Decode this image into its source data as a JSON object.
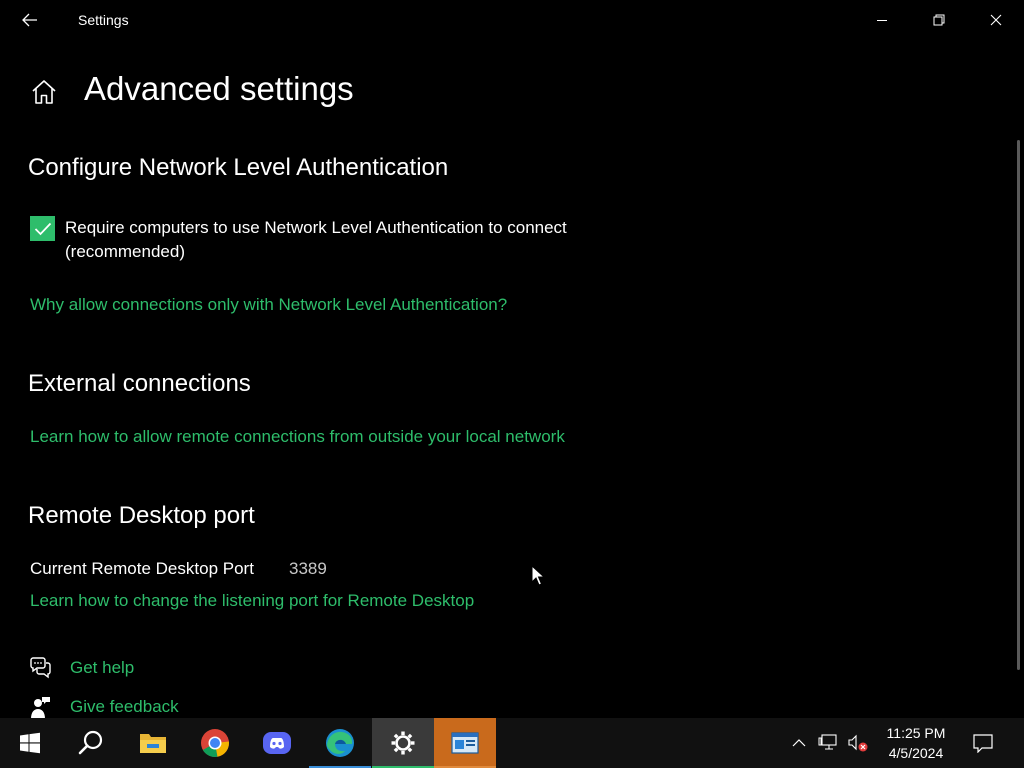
{
  "window": {
    "title": "Settings"
  },
  "page": {
    "title": "Advanced settings"
  },
  "nla": {
    "section_title": "Configure Network Level Authentication",
    "checkbox_label": "Require computers to use Network Level Authentication to connect (recommended)",
    "checkbox_checked": true,
    "link": "Why allow connections only with Network Level Authentication?"
  },
  "external": {
    "section_title": "External connections",
    "link": "Learn how to allow remote connections from outside your local network"
  },
  "port": {
    "section_title": "Remote Desktop port",
    "label": "Current Remote Desktop Port",
    "value": "3389",
    "link": "Learn how to change the listening port for Remote Desktop"
  },
  "help": {
    "get_help": "Get help",
    "give_feedback": "Give feedback"
  },
  "taskbar": {
    "apps": [
      "start-icon",
      "search-icon",
      "file-explorer-icon",
      "chrome-icon",
      "discord-icon",
      "edge-icon",
      "settings-icon",
      "remote-desktop-icon"
    ],
    "time": "11:25 PM",
    "date": "4/5/2024"
  },
  "colors": {
    "accent": "#2ebd6b",
    "taskbar_active": "#c96a1c",
    "background": "#000000"
  }
}
